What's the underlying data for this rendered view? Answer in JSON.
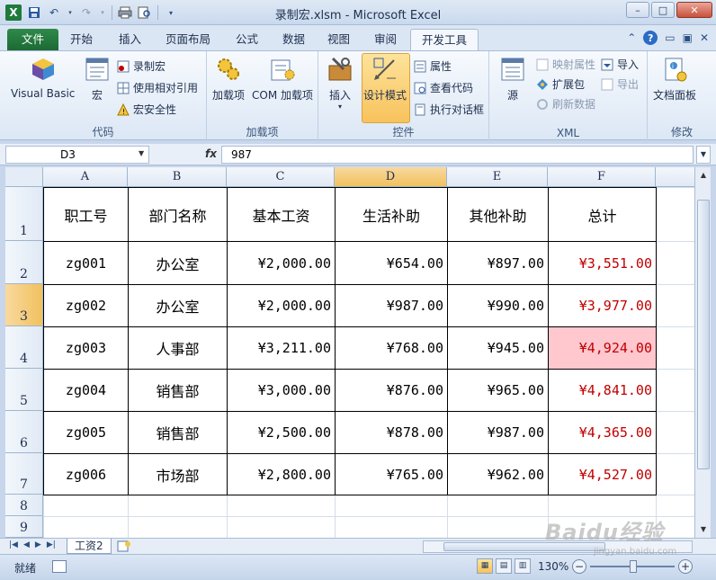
{
  "window": {
    "title": "录制宏.xlsm - Microsoft Excel",
    "minimize": "–",
    "maximize": "□",
    "close": "✕"
  },
  "ribbon_tabs": [
    "文件",
    "开始",
    "插入",
    "页面布局",
    "公式",
    "数据",
    "视图",
    "审阅",
    "开发工具"
  ],
  "active_tab": "开发工具",
  "groups": {
    "code": {
      "label": "代码",
      "visual_basic": "Visual Basic",
      "macro": "宏",
      "record_macro": "录制宏",
      "relative_ref": "使用相对引用",
      "macro_security": "宏安全性"
    },
    "addins": {
      "label": "加载项",
      "addins": "加载项",
      "com_addins": "COM 加载项"
    },
    "controls": {
      "label": "控件",
      "insert": "插入",
      "design_mode": "设计模式",
      "properties": "属性",
      "view_code": "查看代码",
      "run_dialog": "执行对话框"
    },
    "xml": {
      "label": "XML",
      "source": "源",
      "map_properties": "映射属性",
      "expansion_packs": "扩展包",
      "refresh_data": "刷新数据",
      "import": "导入",
      "export": "导出"
    },
    "modify": {
      "label": "修改",
      "document_panel": "文档面板"
    }
  },
  "formula_bar": {
    "name_box": "D3",
    "fx": "fx",
    "value": "987"
  },
  "columns": [
    "A",
    "B",
    "C",
    "D",
    "E",
    "F"
  ],
  "rows": [
    "1",
    "2",
    "3",
    "4",
    "5",
    "6",
    "7",
    "8",
    "9"
  ],
  "table": {
    "headers": [
      "职工号",
      "部门名称",
      "基本工资",
      "生活补助",
      "其他补助",
      "总计"
    ],
    "records": [
      [
        "zg001",
        "办公室",
        "¥2,000.00",
        "¥654.00",
        "¥897.00",
        "¥3,551.00"
      ],
      [
        "zg002",
        "办公室",
        "¥2,000.00",
        "¥987.00",
        "¥990.00",
        "¥3,977.00"
      ],
      [
        "zg003",
        "人事部",
        "¥3,211.00",
        "¥768.00",
        "¥945.00",
        "¥4,924.00"
      ],
      [
        "zg004",
        "销售部",
        "¥3,000.00",
        "¥876.00",
        "¥965.00",
        "¥4,841.00"
      ],
      [
        "zg005",
        "销售部",
        "¥2,500.00",
        "¥878.00",
        "¥987.00",
        "¥4,365.00"
      ],
      [
        "zg006",
        "市场部",
        "¥2,800.00",
        "¥765.00",
        "¥962.00",
        "¥4,527.00"
      ]
    ]
  },
  "highlight_color": "#ffc7ce",
  "total_text_color": "#c00000",
  "sheet_tab": "工资2",
  "status": {
    "ready": "就绪",
    "zoom": "130%"
  },
  "watermark": {
    "brand": "Baidu经验",
    "url": "jingyan.baidu.com"
  }
}
